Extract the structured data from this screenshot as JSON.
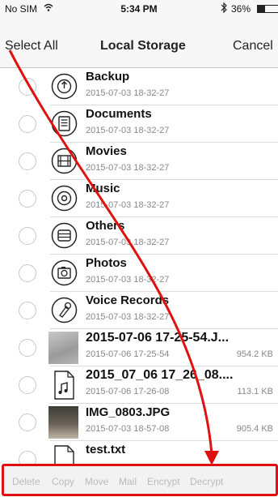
{
  "status": {
    "carrier": "No SIM",
    "time": "5:34 PM",
    "battery": "36%"
  },
  "nav": {
    "left": "Select All",
    "title": "Local Storage",
    "right": "Cancel"
  },
  "files": [
    {
      "name": "Backup",
      "date": "2015-07-03 18-32-27",
      "size": "",
      "icon": "backup-icon"
    },
    {
      "name": "Documents",
      "date": "2015-07-03 18-32-27",
      "size": "",
      "icon": "documents-icon"
    },
    {
      "name": "Movies",
      "date": "2015-07-03 18-32-27",
      "size": "",
      "icon": "movies-icon"
    },
    {
      "name": "Music",
      "date": "2015-07-03 18-32-27",
      "size": "",
      "icon": "music-icon"
    },
    {
      "name": "Others",
      "date": "2015-07-03 18-32-27",
      "size": "",
      "icon": "others-icon"
    },
    {
      "name": "Photos",
      "date": "2015-07-03 18-32-27",
      "size": "",
      "icon": "photos-icon"
    },
    {
      "name": "Voice Records",
      "date": "2015-07-03 18-32-27",
      "size": "",
      "icon": "voice-records-icon"
    },
    {
      "name": "2015-07-06 17-25-54.J...",
      "date": "2015-07-06 17-25-54",
      "size": "954.2 KB",
      "icon": "image-thumbnail"
    },
    {
      "name": "2015_07_06 17_26_08....",
      "date": "2015-07-06 17-26-08",
      "size": "113.1 KB",
      "icon": "audio-file-icon"
    },
    {
      "name": "IMG_0803.JPG",
      "date": "2015-07-03 18-57-08",
      "size": "905.4 KB",
      "icon": "image-thumbnail"
    },
    {
      "name": "test.txt",
      "date": "",
      "size": "",
      "icon": "text-file-icon"
    }
  ],
  "toolbar": {
    "items": [
      "Delete",
      "Copy",
      "Move",
      "Mail",
      "Encrypt",
      "Decrypt"
    ]
  },
  "colors": {
    "annotation": "#e01010",
    "disabled_text": "#bbbbbb"
  }
}
